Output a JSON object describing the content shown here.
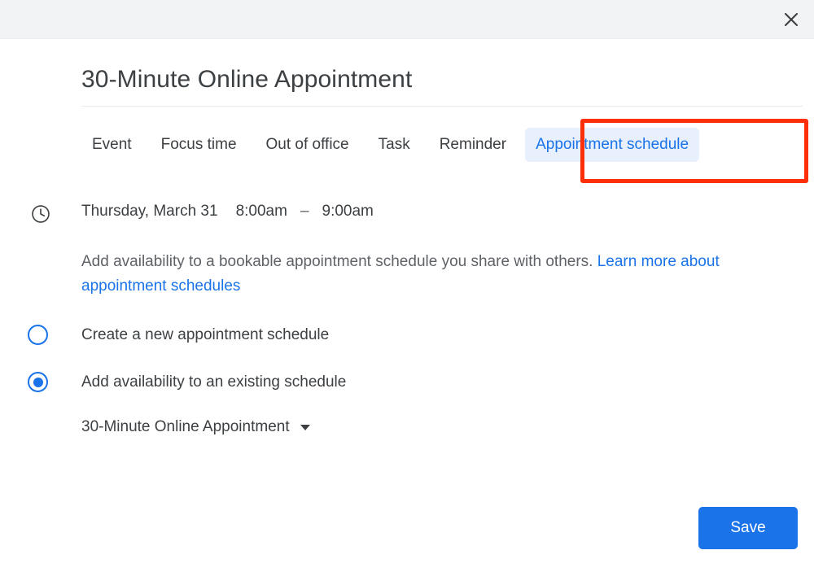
{
  "window": {
    "close_icon": "close-icon"
  },
  "header": {
    "title": "30-Minute Online Appointment"
  },
  "tabs": [
    {
      "label": "Event",
      "active": false
    },
    {
      "label": "Focus time",
      "active": false
    },
    {
      "label": "Out of office",
      "active": false
    },
    {
      "label": "Task",
      "active": false
    },
    {
      "label": "Reminder",
      "active": false
    },
    {
      "label": "Appointment schedule",
      "active": true
    }
  ],
  "annotation": {
    "color": "#fc2f09",
    "target": "Appointment schedule"
  },
  "datetime": {
    "icon": "clock-icon",
    "date": "Thursday, March 31",
    "start_time": "8:00am",
    "dash": "–",
    "end_time": "9:00am"
  },
  "description": {
    "text_before": "Add availability to a bookable appointment schedule you share with others. ",
    "link_text": "Learn more about appointment schedules"
  },
  "options": {
    "create_new": {
      "label": "Create a new appointment schedule",
      "selected": false
    },
    "add_existing": {
      "label": "Add availability to an existing schedule",
      "selected": true
    }
  },
  "schedule_select": {
    "value": "30-Minute Online Appointment",
    "caret_icon": "chevron-down-icon"
  },
  "footer": {
    "save_label": "Save"
  },
  "colors": {
    "accent": "#1a73e8",
    "tab_active_bg": "#e8f0fe",
    "annotation": "#fc2f09",
    "topbar_bg": "#f1f3f4"
  }
}
